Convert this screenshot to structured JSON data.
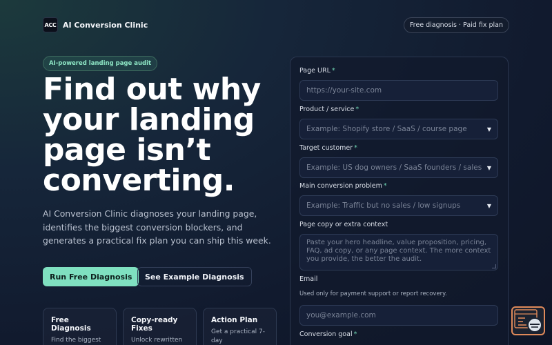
{
  "header": {
    "logo_text": "ACC",
    "brand_name": "AI Conversion Clinic",
    "pricing_pill": "Free diagnosis · Paid fix plan"
  },
  "hero": {
    "badge": "AI-powered landing page audit",
    "title": "Find out why your landing page isn’t converting.",
    "subtitle": "AI Conversion Clinic diagnoses your landing page, identifies the biggest conversion blockers, and generates a practical fix plan you can ship this week.",
    "primary_button": "Run Free Diagnosis",
    "secondary_button": "See Example Diagnosis"
  },
  "features": [
    {
      "title": "Free Diagnosis",
      "body": "Find the biggest blockers hurting"
    },
    {
      "title": "Copy-ready Fixes",
      "body": "Unlock rewritten"
    },
    {
      "title": "Action Plan",
      "body": "Get a practical 7-day"
    }
  ],
  "form": {
    "page_url": {
      "label": "Page URL",
      "placeholder": "https://your-site.com"
    },
    "product": {
      "label": "Product / service",
      "placeholder": "Example: Shopify store / SaaS / course page"
    },
    "target": {
      "label": "Target customer",
      "placeholder": "Example: US dog owners / SaaS founders / sales t"
    },
    "problem": {
      "label": "Main conversion problem",
      "placeholder": "Example: Traffic but no sales / low signups"
    },
    "copy": {
      "label": "Page copy or extra context",
      "placeholder": "Paste your hero headline, value proposition, pricing, FAQ, ad copy, or any page context. The more context you provide, the better the audit."
    },
    "email": {
      "label": "Email",
      "help": "Used only for payment support or report recovery.",
      "placeholder": "you@example.com"
    },
    "goal": {
      "label": "Conversion goal"
    },
    "required_mark": "*",
    "caret": "▼"
  },
  "colors": {
    "accent": "#7fe0c0",
    "widget_border": "#e08a5a"
  },
  "icons": {
    "widget": "chat-support-icon"
  }
}
